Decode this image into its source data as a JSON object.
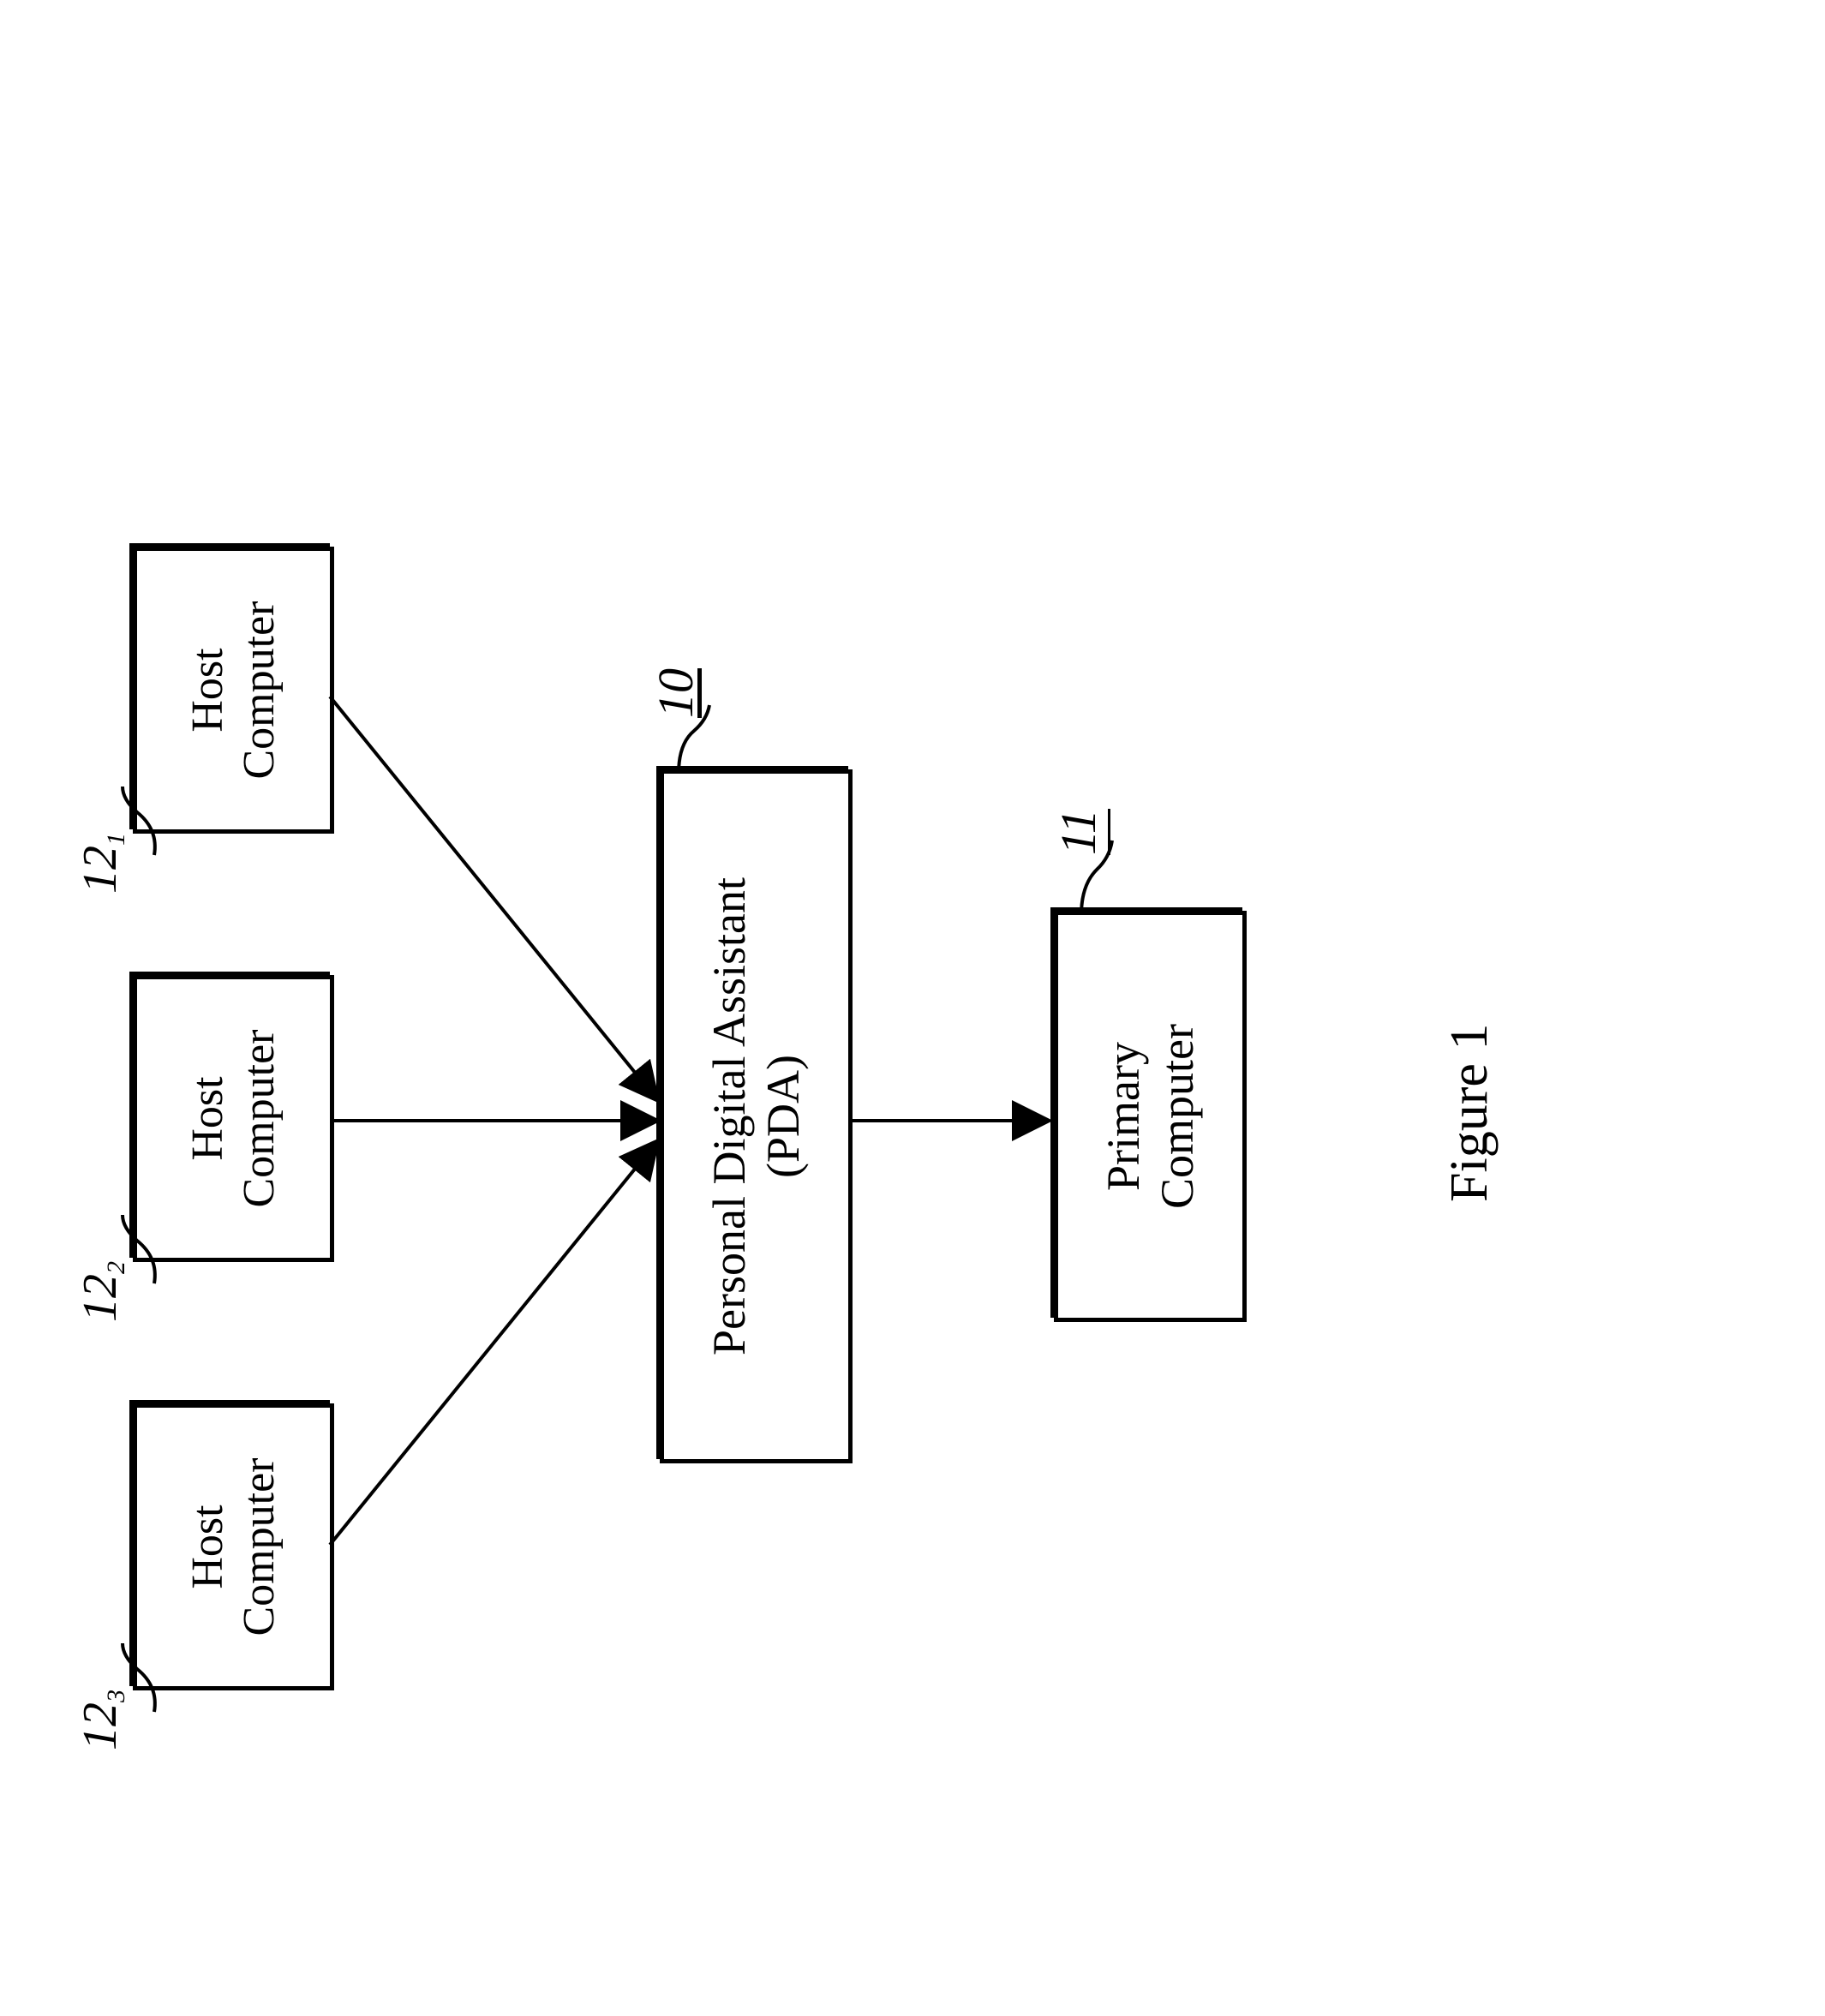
{
  "figure_label": "Figure 1",
  "nodes": {
    "host1": {
      "line1": "Host",
      "line2": "Computer",
      "ref": "12",
      "ref_sub": "1"
    },
    "host2": {
      "line1": "Host",
      "line2": "Computer",
      "ref": "12",
      "ref_sub": "2"
    },
    "host3": {
      "line1": "Host",
      "line2": "Computer",
      "ref": "12",
      "ref_sub": "3"
    },
    "pda": {
      "line1": "Personal Digital Assistant",
      "line2": "(PDA)",
      "ref": "10"
    },
    "primary": {
      "line1": "Primary",
      "line2": "Computer",
      "ref": "11"
    }
  }
}
